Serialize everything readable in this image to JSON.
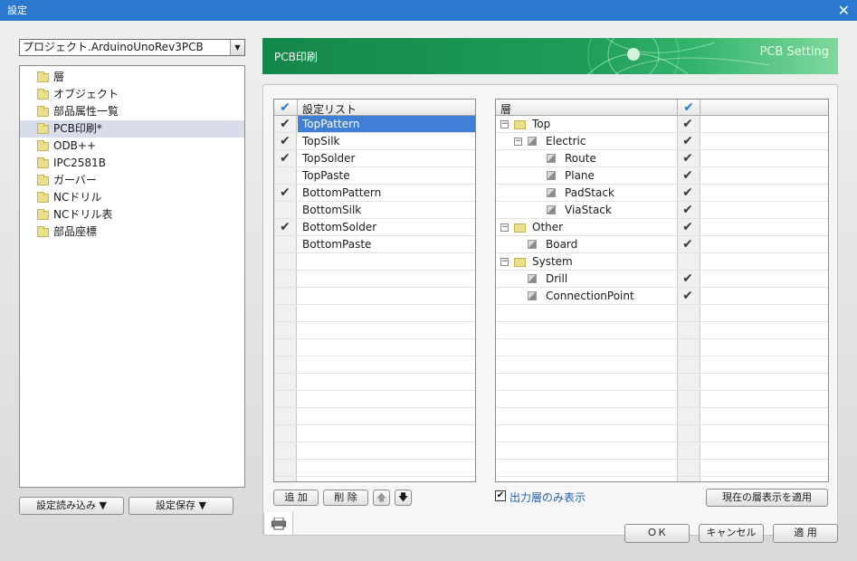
{
  "window": {
    "title": "設定",
    "close": "✕"
  },
  "project_combo": {
    "value": "プロジェクト.ArduinoUnoRev3PCB",
    "arrow": "▼"
  },
  "left_nav": [
    {
      "label": "層",
      "selected": false
    },
    {
      "label": "オブジェクト",
      "selected": false
    },
    {
      "label": "部品属性一覧",
      "selected": false
    },
    {
      "label": "PCB印刷*",
      "selected": true
    },
    {
      "label": "ODB++",
      "selected": false
    },
    {
      "label": "IPC2581B",
      "selected": false
    },
    {
      "label": "ガーバー",
      "selected": false
    },
    {
      "label": "NCドリル",
      "selected": false
    },
    {
      "label": "NCドリル表",
      "selected": false
    },
    {
      "label": "部品座標",
      "selected": false
    }
  ],
  "bottom_left": {
    "load": "設定読み込み ▼",
    "save": "設定保存 ▼"
  },
  "banner": {
    "title": "PCB印刷",
    "subtitle": "PCB Setting"
  },
  "settings_list": {
    "header_check": "✔",
    "header": "設定リスト",
    "rows": [
      {
        "name": "TopPattern",
        "checked": true,
        "selected": true
      },
      {
        "name": "TopSilk",
        "checked": true,
        "selected": false
      },
      {
        "name": "TopSolder",
        "checked": true,
        "selected": false
      },
      {
        "name": "TopPaste",
        "checked": false,
        "selected": false
      },
      {
        "name": "BottomPattern",
        "checked": true,
        "selected": false
      },
      {
        "name": "BottomSilk",
        "checked": false,
        "selected": false
      },
      {
        "name": "BottomSolder",
        "checked": true,
        "selected": false
      },
      {
        "name": "BottomPaste",
        "checked": false,
        "selected": false
      }
    ],
    "add": "追 加",
    "delete": "削 除",
    "up": "🡅",
    "down": "🡇"
  },
  "layer_tree": {
    "header": "層",
    "header_check": "✔",
    "rows": [
      {
        "name": "Top",
        "level": 0,
        "type": "folder",
        "expander": "⊟",
        "checked": true
      },
      {
        "name": "Electric",
        "level": 1,
        "type": "layer",
        "expander": "⊟",
        "checked": true
      },
      {
        "name": "Route",
        "level": 2,
        "type": "layer",
        "expander": "",
        "checked": true
      },
      {
        "name": "Plane",
        "level": 2,
        "type": "layer",
        "expander": "",
        "checked": true
      },
      {
        "name": "PadStack",
        "level": 2,
        "type": "layer",
        "expander": "",
        "checked": true
      },
      {
        "name": "ViaStack",
        "level": 2,
        "type": "layer",
        "expander": "",
        "checked": true
      },
      {
        "name": "Other",
        "level": 0,
        "type": "folder",
        "expander": "⊟",
        "checked": true
      },
      {
        "name": "Board",
        "level": 1,
        "type": "layer",
        "expander": "",
        "checked": true
      },
      {
        "name": "System",
        "level": 0,
        "type": "folder",
        "expander": "⊟",
        "checked": false
      },
      {
        "name": "Drill",
        "level": 1,
        "type": "layer",
        "expander": "",
        "checked": true
      },
      {
        "name": "ConnectionPoint",
        "level": 1,
        "type": "layer",
        "expander": "",
        "checked": true
      }
    ],
    "only_output_label": "出力層のみ表示",
    "apply_current": "現在の層表示を適用"
  },
  "print_tab_icon": "printer-icon",
  "footer": {
    "ok": "ＯＫ",
    "cancel": "キャンセル",
    "apply": "適 用"
  }
}
